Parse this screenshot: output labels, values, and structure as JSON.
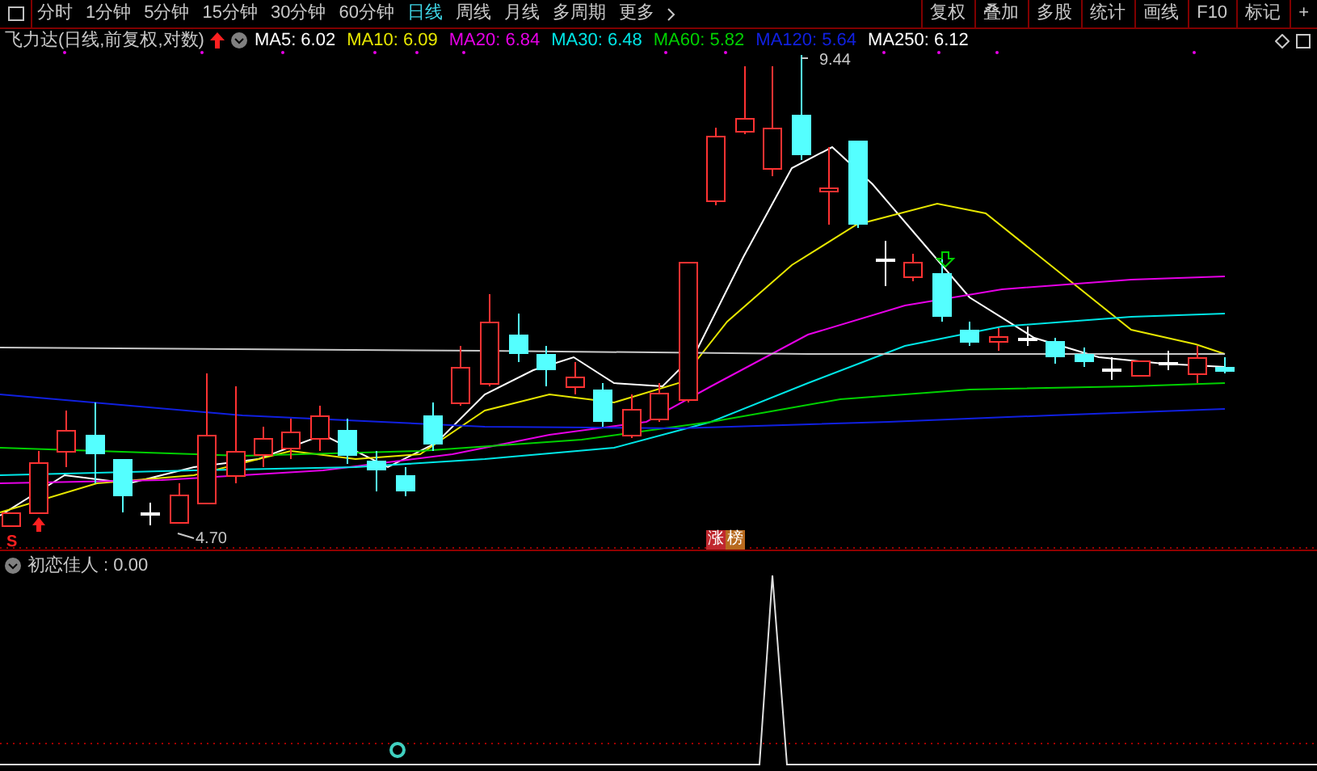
{
  "period_tabs": [
    {
      "label": "分时",
      "selected": false
    },
    {
      "label": "1分钟",
      "selected": false
    },
    {
      "label": "5分钟",
      "selected": false
    },
    {
      "label": "15分钟",
      "selected": false
    },
    {
      "label": "30分钟",
      "selected": false
    },
    {
      "label": "60分钟",
      "selected": false
    },
    {
      "label": "日线",
      "selected": true
    },
    {
      "label": "周线",
      "selected": false
    },
    {
      "label": "月线",
      "selected": false
    },
    {
      "label": "多周期",
      "selected": false
    },
    {
      "label": "更多",
      "selected": false
    }
  ],
  "toolbar_buttons": [
    "复权",
    "叠加",
    "多股",
    "统计",
    "画线",
    "F10",
    "标记",
    "+"
  ],
  "chart_title": "飞力达(日线,前复权,对数)",
  "moving_averages": [
    {
      "label": "MA5: 6.02",
      "color": "#ffffff"
    },
    {
      "label": "MA10: 6.09",
      "color": "#e6e600"
    },
    {
      "label": "MA20: 6.84",
      "color": "#e600e6"
    },
    {
      "label": "MA30: 6.48",
      "color": "#00e6e6"
    },
    {
      "label": "MA60: 5.82",
      "color": "#00d000"
    },
    {
      "label": "MA120: 5.64",
      "color": "#1020e0"
    },
    {
      "label": "MA250: 6.12",
      "color": "#ffffff"
    }
  ],
  "high_label": "9.44",
  "low_label": "4.70",
  "signal_mark": "S",
  "tags": [
    {
      "text": "涨",
      "color": "#c0282f"
    },
    {
      "text": "榜",
      "color": "#b86a1e"
    }
  ],
  "indicator_label": "初恋佳人 : 0.00"
}
